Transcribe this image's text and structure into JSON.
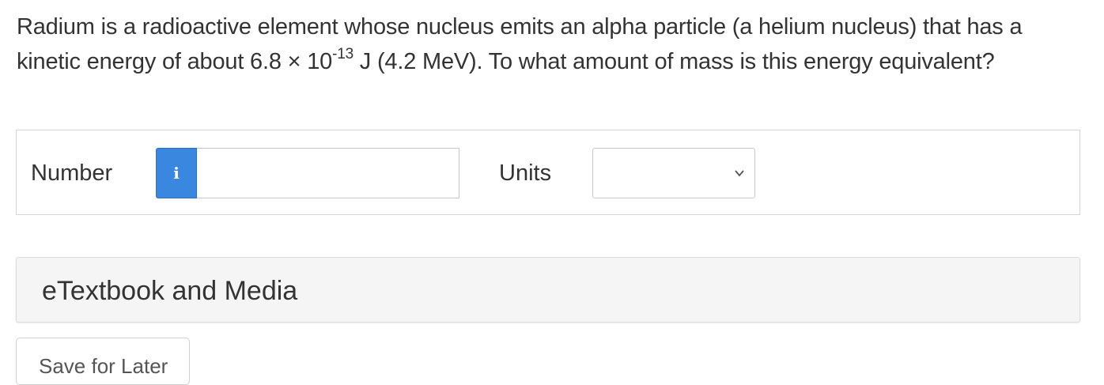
{
  "question": {
    "part1": "Radium is a radioactive element whose nucleus emits an alpha particle (a helium nucleus) that has a kinetic energy of about 6.8 × 10",
    "exponent": "-13",
    "part2": " J (4.2 MeV). To what amount of mass is this energy equivalent?"
  },
  "answer": {
    "number_label": "Number",
    "info_icon_glyph": "i",
    "number_value": "",
    "units_label": "Units",
    "units_selected": ""
  },
  "etextbook": {
    "title": "eTextbook and Media"
  },
  "partial_button": {
    "label": "Save for Later"
  },
  "colors": {
    "info_button": "#3a87e0",
    "panel_bg": "#f5f5f5",
    "text": "#333333"
  },
  "icons": {
    "info": "info-icon",
    "dropdown": "chevron-down-icon"
  }
}
